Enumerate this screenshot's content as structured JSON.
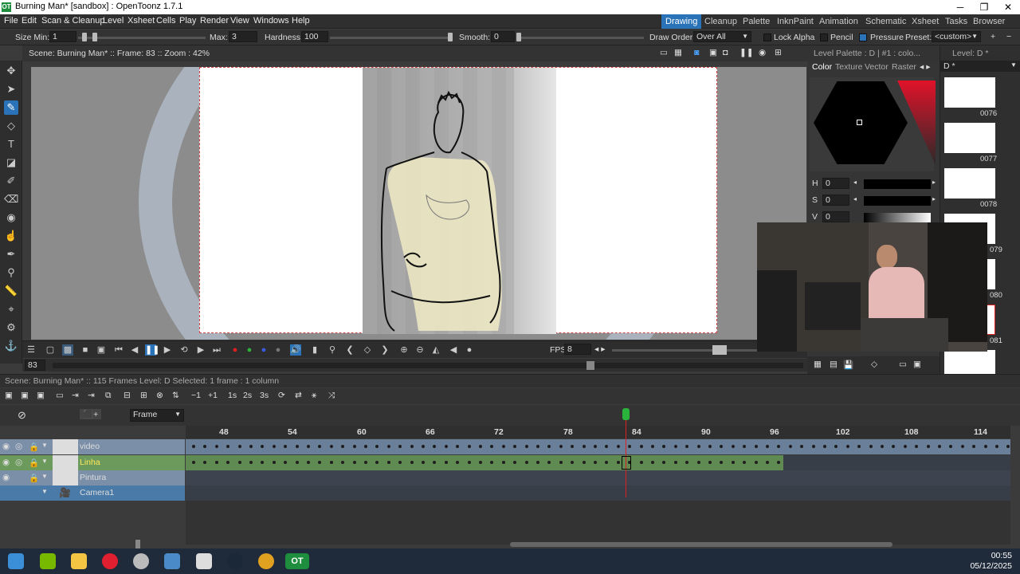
{
  "window": {
    "title": "Burning Man* [sandbox] : OpenToonz 1.7.1",
    "icon": "OT"
  },
  "menus": [
    "File",
    "Edit",
    "Scan & Cleanup",
    "Level",
    "Xsheet",
    "Cells",
    "Play",
    "Render",
    "View",
    "Windows",
    "Help"
  ],
  "rooms": [
    "Drawing",
    "Cleanup",
    "Palette",
    "InknPaint",
    "Animation",
    "Schematic",
    "Xsheet",
    "Tasks",
    "Browser"
  ],
  "tool_options": {
    "size_min_label": "Size Min:",
    "size_min": "1",
    "max_label": "Max:",
    "max": "3",
    "hardness_label": "Hardness:",
    "hardness": "100",
    "smooth_label": "Smooth:",
    "smooth": "0",
    "draw_order_label": "Draw Order:",
    "draw_order": "Over All",
    "lock_alpha": "Lock Alpha",
    "pencil": "Pencil",
    "pressure": "Pressure",
    "preset_label": "Preset:",
    "preset": "<custom>"
  },
  "viewer": {
    "info": "Scene: Burning Man*  ::  Frame: 83  ::  Zoom : 42%",
    "fps_label": "FPS",
    "fps": "8",
    "frame": "83"
  },
  "palette": {
    "title": "Level Palette : D | #1 : colo...",
    "tabs": [
      "Color",
      "Texture",
      "Vector",
      "Raster"
    ],
    "h_label": "H",
    "h": "0",
    "s_label": "S",
    "s": "0",
    "v_label": "V",
    "v": "0"
  },
  "level_strip": {
    "title": "Level:  D *",
    "level_name": "D *",
    "frames": [
      "0076",
      "0077",
      "0078",
      "079",
      "080",
      "081"
    ]
  },
  "xsheet": {
    "status": "Scene: Burning Man*  ::  115 Frames  Level: D  Selected: 1 frame : 1 column",
    "frame_mode": "Frame",
    "ruler": [
      "48",
      "54",
      "60",
      "66",
      "72",
      "78",
      "84",
      "90",
      "96",
      "102",
      "108",
      "114"
    ],
    "columns": [
      {
        "name": "video",
        "color": "#7b8fa8"
      },
      {
        "name": "Linha",
        "color": "#6b9a5c"
      },
      {
        "name": "Pintura",
        "color": "#7b8fa8"
      },
      {
        "name": "Camera1",
        "color": "#4a7aa8"
      }
    ]
  },
  "taskbar": {
    "time": "00:55",
    "date": "05/12/2025"
  }
}
